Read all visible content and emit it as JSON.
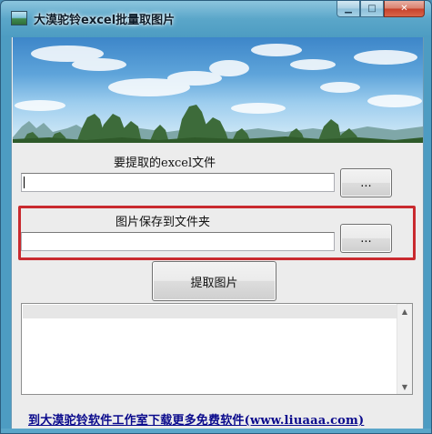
{
  "window": {
    "title": "大漠驼铃excel批量取图片",
    "min_glyph": "▁",
    "max_glyph": "□",
    "close_glyph": "✕"
  },
  "form": {
    "excel_label": "要提取的excel文件",
    "excel_value": "",
    "browse_excel_label": "...",
    "folder_label": "图片保存到文件夹",
    "folder_value": "",
    "browse_folder_label": "...",
    "extract_button_label": "提取图片"
  },
  "log": {
    "up_arrow": "▲",
    "down_arrow": "▼"
  },
  "footer": {
    "link_text": "到大漠驼铃软件工作室下载更多免费软件(www.liuaaa.com)"
  },
  "colors": {
    "highlight": "#c92a2f",
    "link": "#0a0a8c"
  },
  "icons": {
    "app": "landscape-icon",
    "banner": "karst-landscape-banner"
  }
}
